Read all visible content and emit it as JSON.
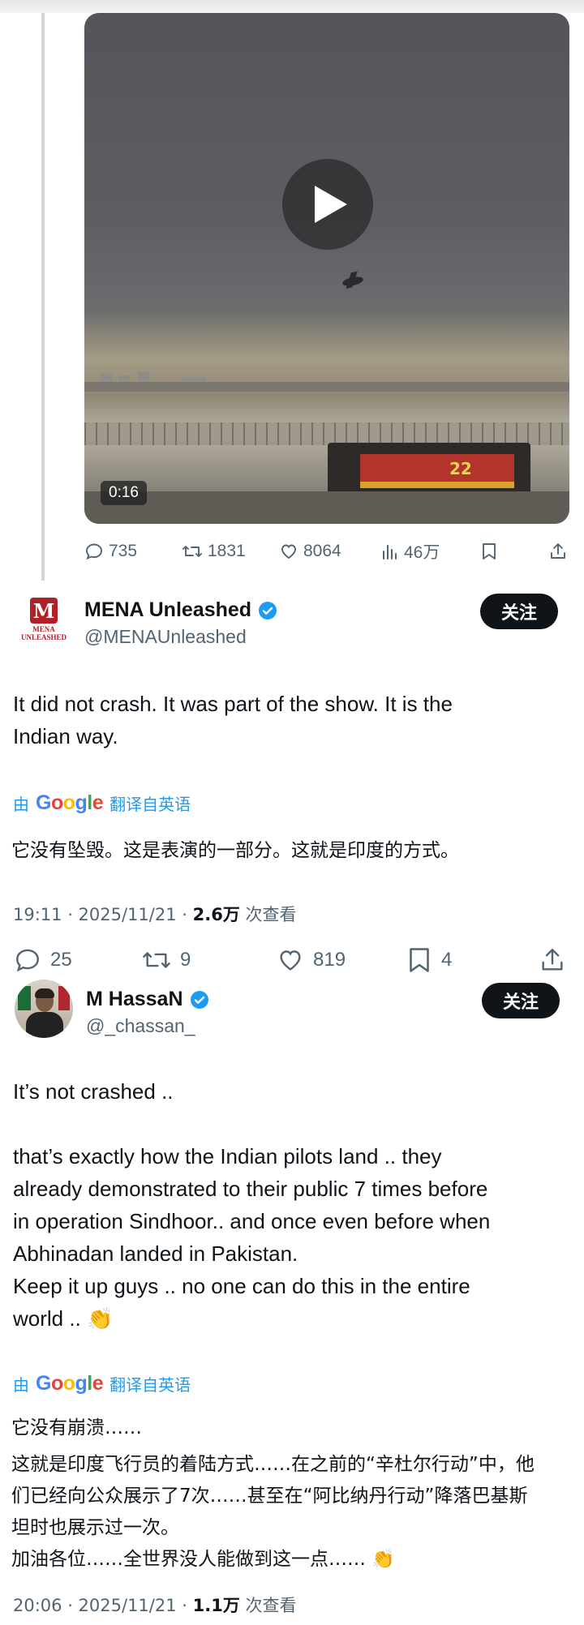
{
  "video": {
    "duration": "0:16",
    "truck_number": "22"
  },
  "quoted_actions": {
    "replies": "735",
    "retweets": "1831",
    "likes": "8064",
    "views": "46万"
  },
  "tweet1": {
    "display_name": "MENA Unleashed",
    "handle": "@MENAUnleashed",
    "avatar_text": "MENA UNLEASHED",
    "follow_label": "关注",
    "text_lines": [
      "It did not crash. It was part of the show. It is the",
      "Indian way."
    ],
    "translate_by": "由",
    "translate_from": "翻译自英语",
    "translated_text": "它没有坠毁。这是表演的一部分。这就是印度的方式。",
    "time": "19:11 · 2025/11/21 · ",
    "views": "2.6万",
    "views_suffix": " 次查看",
    "replies": "25",
    "retweets": "9",
    "likes": "819",
    "bookmarks": "4"
  },
  "tweet2": {
    "display_name": "M HassaN",
    "handle": "@_chassan_",
    "follow_label": "关注",
    "text_lines": [
      "It’s not crashed ..",
      "",
      "that’s exactly how the Indian pilots land .. they",
      "already demonstrated to their public 7 times before",
      "in operation Sindhoor.. and once even before when",
      "Abhinadan landed in Pakistan.",
      "Keep it up guys .. no one can do this in the entire",
      "world .. 👏"
    ],
    "translate_by": "由",
    "translate_from": "翻译自英语",
    "translated_lines": [
      "它没有崩溃……",
      "这就是印度飞行员的着陆方式……在之前的“辛杜尔行动”中，他",
      "们已经向公众展示了7次……甚至在“阿比纳丹行动”降落巴基斯",
      "坦时也展示过一次。",
      "加油各位……全世界没人能做到这一点…… 👏"
    ],
    "time": "20:06 · 2025/11/21 · ",
    "views": "1.1万",
    "views_suffix": " 次查看"
  },
  "google_letters": [
    "G",
    "o",
    "o",
    "g",
    "l",
    "e"
  ],
  "colors": {
    "accent": "#1d9bf0",
    "text": "#0f1419",
    "muted": "#536471",
    "verified": "#1d9bf0"
  }
}
